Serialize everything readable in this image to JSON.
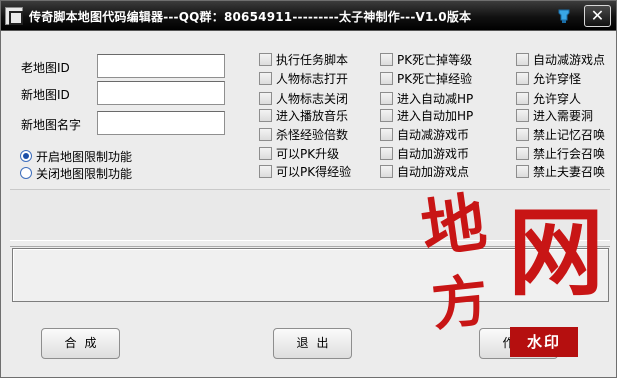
{
  "window": {
    "title": "传奇脚本地图代码编辑器---QQ群：80654911---------太子神制作---V1.0版本",
    "close_glyph": "✕"
  },
  "form": {
    "old_map_id_label": "老地图ID",
    "new_map_id_label": "新地图ID",
    "new_map_name_label": "新地图名字",
    "old_map_id_value": "",
    "new_map_id_value": "",
    "new_map_name_value": ""
  },
  "radios": [
    {
      "label": "开启地图限制功能",
      "checked": true
    },
    {
      "label": "关闭地图限制功能",
      "checked": false
    }
  ],
  "checkbox_columns": [
    [
      "执行任务脚本",
      "人物标志打开",
      "人物标志关闭",
      "进入播放音乐",
      "杀怪经验倍数",
      "可以PK升级",
      "可以PK得经验"
    ],
    [
      "PK死亡掉等级",
      "PK死亡掉经验",
      "进入自动减HP",
      "进入自动加HP",
      "自动减游戏币",
      "自动加游戏币",
      "自动加游戏点"
    ],
    [
      "自动减游戏点",
      "允许穿怪",
      "允许穿人",
      "进入需要洞",
      "禁止记忆召唤",
      "禁止行会召唤",
      "禁止夫妻召唤"
    ]
  ],
  "buttons": {
    "generate": "合成",
    "exit": "退出",
    "author": "作者"
  },
  "watermark": {
    "char1": "地",
    "char2": "方",
    "char3": "网",
    "stamp": "水印"
  },
  "colors": {
    "titlebar": "#000000",
    "watermark_red": "#c81515"
  }
}
